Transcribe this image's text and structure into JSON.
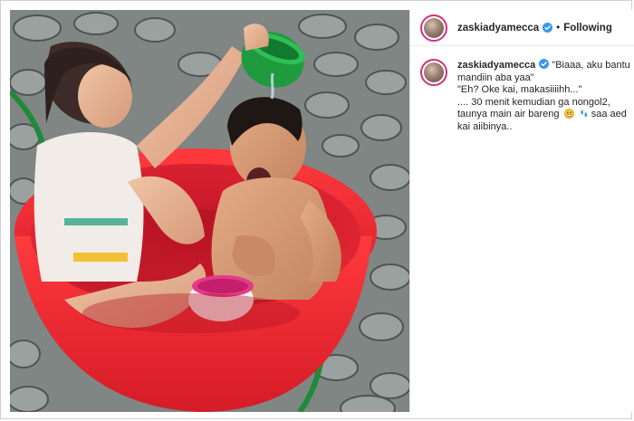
{
  "post": {
    "username": "zaskiadyamecca",
    "separator": "•",
    "follow_status": "Following",
    "verified": true
  },
  "caption": {
    "username": "zaskiadyamecca",
    "line1": "\"Biaaa, aku bantu",
    "line2": "mandiin aba yaa\"",
    "line3": "\"Eh? Oke kai, makasiiiihh...\"",
    "line4": ".... 30 menit kemudian ga nongol2,",
    "line5_before": "taunya main air bareng",
    "line5_after": "saa aed",
    "line6": "kai aiibinya..",
    "emojis": [
      "grimacing-face-emoji",
      "water-drops-emoji"
    ]
  },
  "photo": {
    "description_icon": "kids-bathing-photo"
  },
  "colors": {
    "story_ring": "#d6307a",
    "verified_badge": "#3897f0",
    "text": "#262626",
    "tub_red": "#e8232e",
    "bowl_green": "#1f9a3f"
  }
}
